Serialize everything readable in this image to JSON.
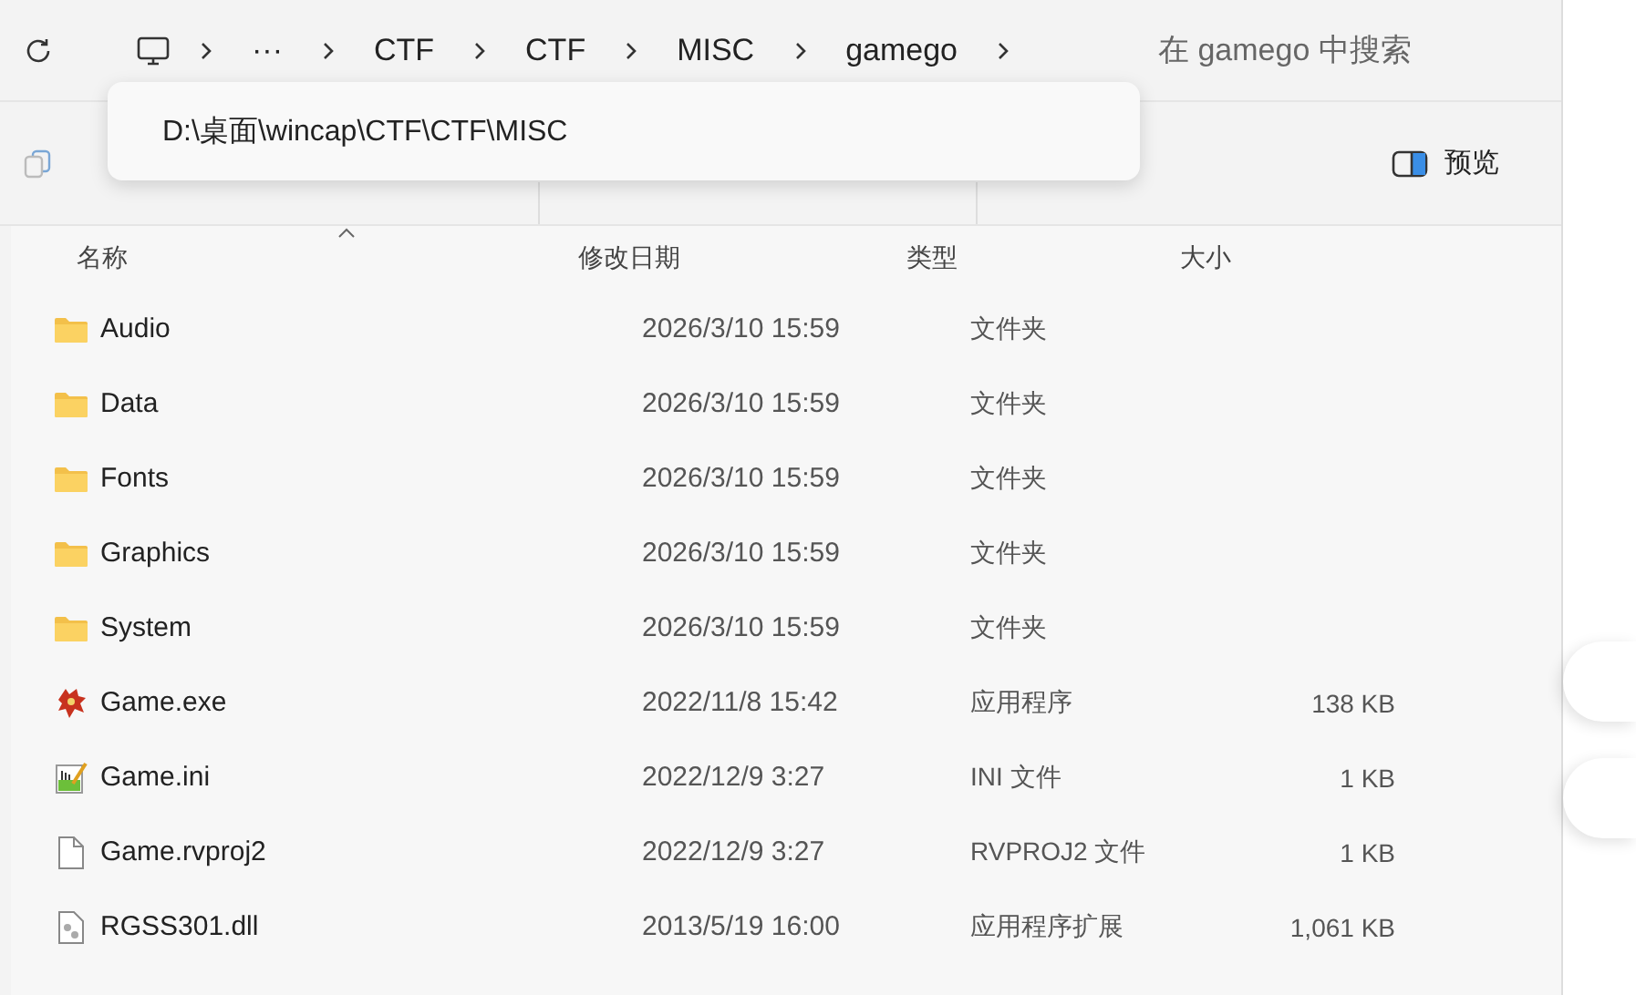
{
  "breadcrumb": [
    {
      "kind": "computer"
    },
    {
      "kind": "more",
      "label": "···"
    },
    {
      "kind": "folder",
      "label": "CTF"
    },
    {
      "kind": "folder",
      "label": "CTF"
    },
    {
      "kind": "folder",
      "label": "MISC"
    },
    {
      "kind": "folder",
      "label": "gamego"
    }
  ],
  "search": {
    "placeholder": "在 gamego 中搜索"
  },
  "address_popup": {
    "text": "D:\\桌面\\wincap\\CTF\\CTF\\MISC"
  },
  "toolbar": {
    "preview_button": "预览"
  },
  "columns": [
    {
      "label": "名称",
      "sorted": true
    },
    {
      "label": "修改日期",
      "sorted": false
    },
    {
      "label": "类型",
      "sorted": false
    },
    {
      "label": "大小",
      "sorted": false
    }
  ],
  "rows": [
    {
      "kind": "folder",
      "name": "Audio",
      "modified": "2026/3/10 15:59",
      "type": "文件夹"
    },
    {
      "kind": "folder",
      "name": "Data",
      "modified": "2026/3/10 15:59",
      "type": "文件夹"
    },
    {
      "kind": "folder",
      "name": "Fonts",
      "modified": "2026/3/10 15:59",
      "type": "文件夹"
    },
    {
      "kind": "folder",
      "name": "Graphics",
      "modified": "2026/3/10 15:59",
      "type": "文件夹"
    },
    {
      "kind": "folder",
      "name": "System",
      "modified": "2026/3/10 15:59",
      "type": "文件夹"
    },
    {
      "kind": "exe",
      "name": "Game.exe",
      "modified": "2022/11/8 15:42",
      "type": "应用程序",
      "size": "138 KB"
    },
    {
      "kind": "ini",
      "name": "Game.ini",
      "modified": "2022/12/9 3:27",
      "type": "INI 文件",
      "size": "1 KB"
    },
    {
      "kind": "file",
      "name": "Game.rvproj2",
      "modified": "2022/12/9 3:27",
      "type": "RVPROJ2 文件",
      "size": "1 KB"
    },
    {
      "kind": "dll",
      "name": "RGSS301.dll",
      "modified": "2013/5/19 16:00",
      "type": "应用程序扩展",
      "size": "1,061 KB"
    }
  ]
}
